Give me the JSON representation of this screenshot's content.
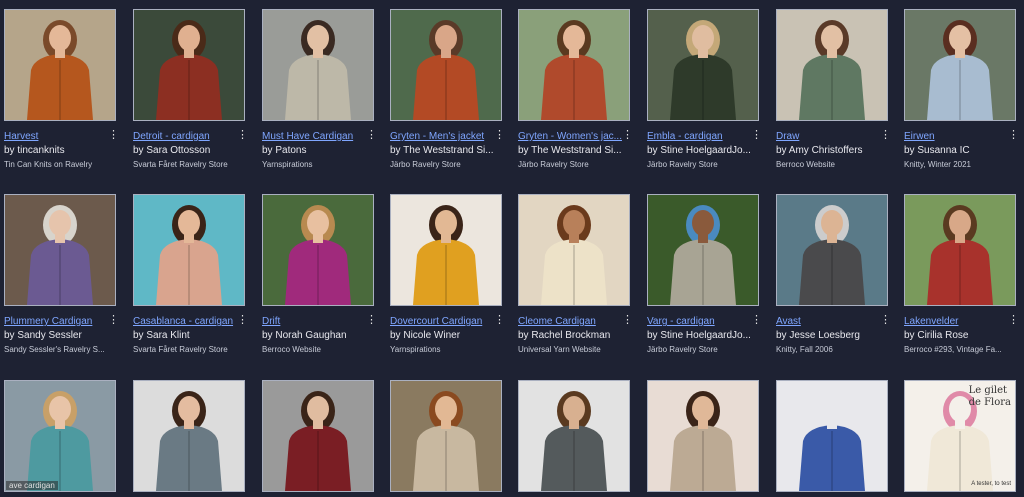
{
  "colors": {
    "background": "#1e2233",
    "link": "#7fa6ff",
    "text": "#e8e8ee"
  },
  "menu_icon": "more-vertical-icon",
  "rows": [
    [
      {
        "title": "Harvest",
        "by": "by",
        "author": "tincanknits",
        "source": "Tin Can Knits on Ravelry",
        "bg": "#b5a58a",
        "garment": "#b5571e",
        "skin": "#e4b898",
        "hair": "#7a4a2a"
      },
      {
        "title": "Detroit - cardigan",
        "by": "by",
        "author": "Sara Ottosson",
        "source": "Svarta Fåret Ravelry Store",
        "bg": "#3b4a3a",
        "garment": "#8c2f22",
        "skin": "#e0b090",
        "hair": "#4a2a18"
      },
      {
        "title": "Must Have Cardigan",
        "by": "by",
        "author": "Patons",
        "source": "Yarnspirations",
        "bg": "#9a9c98",
        "garment": "#bdb8a8",
        "skin": "#e2c0a4",
        "hair": "#3a2a22"
      },
      {
        "title": "Gryten - Men's jacket",
        "by": "by",
        "author": "The Weststrand Si...",
        "source": "Järbo Ravelry Store",
        "bg": "#4f6a4c",
        "garment": "#b34a25",
        "skin": "#d9a688",
        "hair": "#5a3a28"
      },
      {
        "title": "Gryten - Women's jac...",
        "by": "by",
        "author": "The Weststrand Si...",
        "source": "Järbo Ravelry Store",
        "bg": "#8aa07a",
        "garment": "#b04a2c",
        "skin": "#e4b898",
        "hair": "#5a3a20"
      },
      {
        "title": "Embla - cardigan",
        "by": "by",
        "author": "Stine HoelgaardJo...",
        "source": "Järbo Ravelry Store",
        "bg": "#54604c",
        "garment": "#2e3a2a",
        "skin": "#e0bda0",
        "hair": "#c4a878"
      },
      {
        "title": "Draw",
        "by": "by",
        "author": "Amy Christoffers",
        "source": "Berroco Website",
        "bg": "#c9c2b4",
        "garment": "#5f7862",
        "skin": "#e2c0a4",
        "hair": "#5a3a28"
      },
      {
        "title": "Eirwen",
        "by": "by",
        "author": "Susanna IC",
        "source": "Knitty, Winter 2021",
        "bg": "#6a7866",
        "garment": "#a8bcd0",
        "skin": "#e4c0a4",
        "hair": "#5a2e20"
      }
    ],
    [
      {
        "title": "Plummery Cardigan",
        "by": "by",
        "author": "Sandy Sessler",
        "source": "Sandy Sessler's Ravelry S...",
        "bg": "#6c5a4c",
        "garment": "#6b5a92",
        "skin": "#e6c4ac",
        "hair": "#d8d4cc"
      },
      {
        "title": "Casablanca - cardigan",
        "by": "by",
        "author": "Sara Klint",
        "source": "Svarta Fåret Ravelry Store",
        "bg": "#5fb8c6",
        "garment": "#d9a48e",
        "skin": "#e4b898",
        "hair": "#3a2418"
      },
      {
        "title": "Drift",
        "by": "by",
        "author": "Norah Gaughan",
        "source": "Berroco Website",
        "bg": "#4a6a3c",
        "garment": "#a02a7c",
        "skin": "#e8c0a0",
        "hair": "#b88a50"
      },
      {
        "title": "Dovercourt Cardigan",
        "by": "by",
        "author": "Nicole Winer",
        "source": "Yarnspirations",
        "bg": "#ece6de",
        "garment": "#e0a020",
        "skin": "#e2b894",
        "hair": "#3a2418"
      },
      {
        "title": "Cleome Cardigan",
        "by": "by",
        "author": "Rachel Brockman",
        "source": "Universal Yarn Website",
        "bg": "#e2d6c2",
        "garment": "#ede2c8",
        "skin": "#b8805a",
        "hair": "#6a3a1c"
      },
      {
        "title": "Varg - cardigan",
        "by": "by",
        "author": "Stine HoelgaardJo...",
        "source": "Järbo Ravelry Store",
        "bg": "#3a5a2a",
        "garment": "#a8a494",
        "skin": "#8a5a3c",
        "hair": "#4a8ac0"
      },
      {
        "title": "Avast",
        "by": "by",
        "author": "Jesse Loesberg",
        "source": "Knitty, Fall 2006",
        "bg": "#5a7a88",
        "garment": "#4a4a4c",
        "skin": "#dcb494",
        "hair": "#cccccc"
      },
      {
        "title": "Lakenvelder",
        "by": "by",
        "author": "Cirilia Rose",
        "source": "Berroco #293, Vintage Fa...",
        "bg": "#7a9a5c",
        "garment": "#a8322c",
        "skin": "#d8a888",
        "hair": "#5a3a20"
      }
    ],
    [
      {
        "title": "",
        "by": "",
        "author": "",
        "source": "",
        "overlay": "ave cardigan",
        "bg": "#8a9aa4",
        "garment": "#4e9aa0",
        "skin": "#e8c4a8",
        "hair": "#c8a068"
      },
      {
        "title": "",
        "by": "",
        "author": "",
        "source": "",
        "bg": "#dcdcdc",
        "garment": "#6a7a84",
        "skin": "#e4bca0",
        "hair": "#3a2418"
      },
      {
        "title": "",
        "by": "",
        "author": "",
        "source": "",
        "bg": "#9a9a9a",
        "garment": "#7a1e24",
        "skin": "#e0bca0",
        "hair": "#3a2418"
      },
      {
        "title": "",
        "by": "",
        "author": "",
        "source": "",
        "bg": "#8a7a60",
        "garment": "#c8b8a0",
        "skin": "#e2b894",
        "hair": "#8a4a20"
      },
      {
        "title": "",
        "by": "",
        "author": "",
        "source": "",
        "bg": "#e2e2e2",
        "garment": "#545a5c",
        "skin": "#d8b090",
        "hair": "#5a3a20"
      },
      {
        "title": "",
        "by": "",
        "author": "",
        "source": "",
        "bg": "#e8dcd4",
        "garment": "#bcaa94",
        "skin": "#e0b898",
        "hair": "#3a2418"
      },
      {
        "title": "",
        "by": "",
        "author": "",
        "source": "",
        "bg": "#e8e8ec",
        "garment": "#3a5aa8",
        "skin": "#e8e8ec",
        "hair": "#e8e8ec"
      },
      {
        "title": "",
        "by": "",
        "author": "",
        "source": "",
        "overlay_title": "Le gilet\nde Flora",
        "overlay_caption": "A tester, to test",
        "bg": "#f4f0ea",
        "garment": "#f0e8d8",
        "skin": "#f4f0ea",
        "hair": "#e08aa8"
      }
    ]
  ]
}
